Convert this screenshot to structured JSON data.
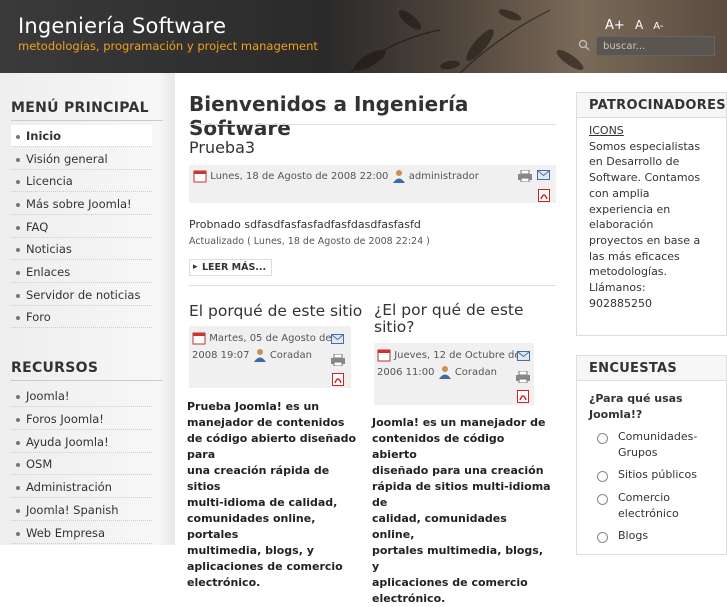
{
  "header": {
    "title": "Ingeniería Software",
    "slogan": "metodologías, programación y project management",
    "font_size_controls": [
      "A+",
      "A",
      "A-"
    ],
    "search_placeholder": "buscar...",
    "colors": {
      "slogan": "#f0a020",
      "header_bg": "#2e2e2e"
    }
  },
  "left": {
    "menu_title": "MENÚ PRINCIPAL",
    "menu_items": [
      "Inicio",
      "Visión general",
      "Licencia",
      "Más sobre Joomla!",
      "FAQ",
      "Noticias",
      "Enlaces",
      "Servidor de noticias",
      "Foro"
    ],
    "active_item": "Inicio",
    "resources_title": "RECURSOS",
    "resource_items": [
      "Joomla!",
      "Foros Joomla!",
      "Ayuda Joomla!",
      "OSM",
      "Administración",
      "Joomla! Spanish",
      "Web Empresa"
    ]
  },
  "main": {
    "page_title": "Bienvenidos a Ingeniería Software",
    "lead": {
      "title": "Prueba3",
      "date": "Lunes, 18 de Agosto de 2008 22:00",
      "author": "administrador",
      "body": "Probnado sdfasdfasfasfadfasfdasdfasfasfd",
      "updated": "Actualizado ( Lunes, 18 de Agosto de 2008 22:24 )",
      "read_more": "LEER MÁS..."
    },
    "col1": {
      "title": "El porqué de este sitio",
      "date_line1": "Martes, 05 de Agosto de",
      "date_line2": "2008 19:07",
      "author": "Coradan",
      "body": [
        "Prueba Joomla! es un",
        "manejador de contenidos",
        "de código abierto diseñado para",
        "una creación rápida de sitios",
        "multi-idioma de calidad,",
        "comunidades online, portales",
        "multimedia, blogs, y",
        "aplicaciones de comercio",
        "electrónico."
      ]
    },
    "col2": {
      "title_line1": "¿El por qué de este",
      "title_line2": "sitio?",
      "date_line1": "Jueves, 12 de Octubre de",
      "date_line2": "2006 11:00",
      "author": "Coradan",
      "body": [
        "Joomla! es un manejador de",
        "contenidos de código abierto",
        "diseñado para una creación",
        "rápida de sitios multi-idioma de",
        "calidad, comunidades online,",
        "portales multimedia, blogs, y",
        "aplicaciones de comercio",
        "electrónico."
      ]
    }
  },
  "right": {
    "sponsors_title": "PATROCINADORES",
    "sponsors_link": "ICONS",
    "sponsors_lines": [
      "Somos especialistas",
      "en Desarrollo de",
      "Software. Contamos",
      "con amplia",
      "experiencia en",
      "elaboración",
      "proyectos en base a",
      "las más eficaces",
      "metodologías.",
      "Llámanos:",
      "902885250"
    ],
    "poll_title": "ENCUESTAS",
    "poll_question_line1": "¿Para qué usas",
    "poll_question_line2": "Joomla!?",
    "poll_options": [
      [
        "Comunidades-",
        "Grupos"
      ],
      [
        "Sitios públicos"
      ],
      [
        "Comercio",
        "electrónico"
      ],
      [
        "Blogs"
      ]
    ]
  }
}
